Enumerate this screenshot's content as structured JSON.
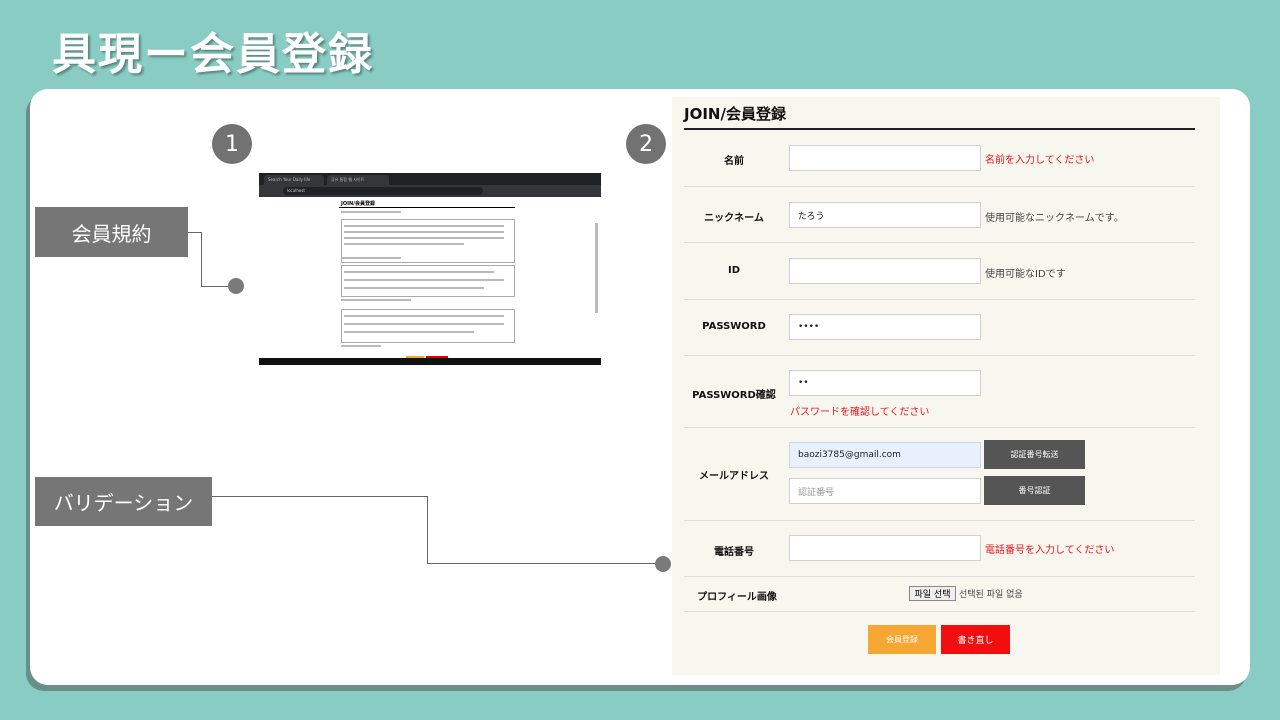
{
  "slide": {
    "title": "具現ー会員登録",
    "step1": "1",
    "step2": "2",
    "label_terms": "会員規約",
    "label_validation": "バリデーション"
  },
  "thumbnail": {
    "tab1": "Search Your Daily life",
    "tab2": "공유 통합 웹 사이트",
    "url": "localhost",
    "page_title": "JOIN/会員登録"
  },
  "form": {
    "title": "JOIN/会員登録",
    "fields": {
      "name": {
        "label": "名前",
        "value": "",
        "message": "名前を入力してください"
      },
      "nickname": {
        "label": "ニックネーム",
        "value": "たろう",
        "message": "使用可能なニックネームです。"
      },
      "id": {
        "label": "ID",
        "value": "",
        "message": "使用可能なIDです"
      },
      "password": {
        "label": "PASSWORD",
        "value": "••••"
      },
      "password_confirm": {
        "label": "PASSWORD確認",
        "value": "••",
        "message": "パスワードを確認してください"
      },
      "email": {
        "label": "メールアドレス",
        "value": "baozi3785@gmail.com",
        "send_button": "認証番号転送",
        "code_placeholder": "認証番号",
        "verify_button": "番号認証"
      },
      "phone": {
        "label": "電話番号",
        "value": "",
        "message": "電話番号を入力してください"
      },
      "profile_image": {
        "label": "プロフィール画像",
        "file_button": "파일 선택",
        "file_status": "선택된 파일 없음"
      }
    },
    "register_button": "会員登録",
    "reset_button": "書き直し"
  }
}
